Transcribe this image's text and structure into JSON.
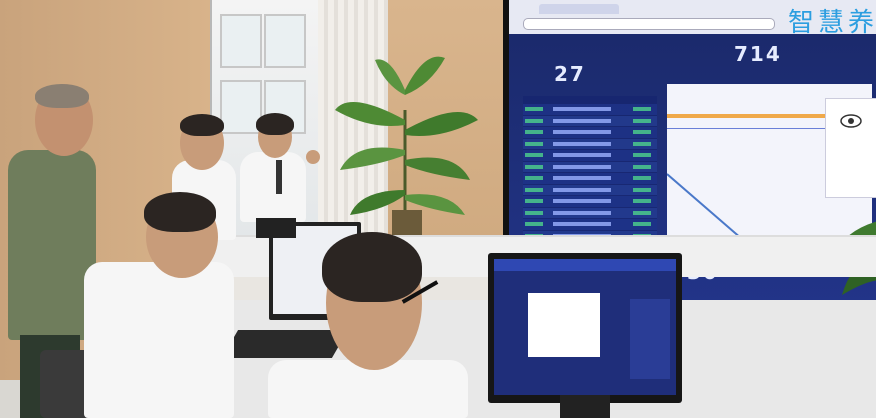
{
  "videowall": {
    "title": "智慧养",
    "stat_left": "27",
    "stat_top": "714",
    "stat_bottom": "30",
    "accent_color": "#2c9ee0",
    "background_color": "#1f2b6e"
  },
  "front_monitor": {
    "background_color": "#1f2e7a"
  }
}
